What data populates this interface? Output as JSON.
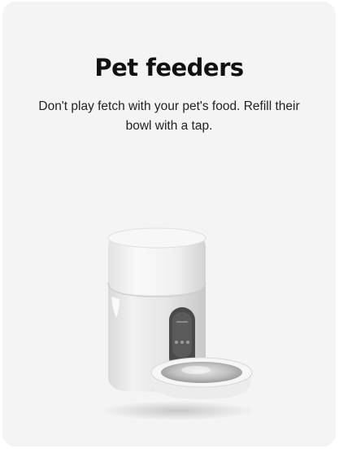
{
  "card": {
    "title": "Pet feeders",
    "description": "Don't play fetch with your pet's food. Refill their bowl with a tap.",
    "image_alt": "smart-pet-feeder-product-image"
  }
}
